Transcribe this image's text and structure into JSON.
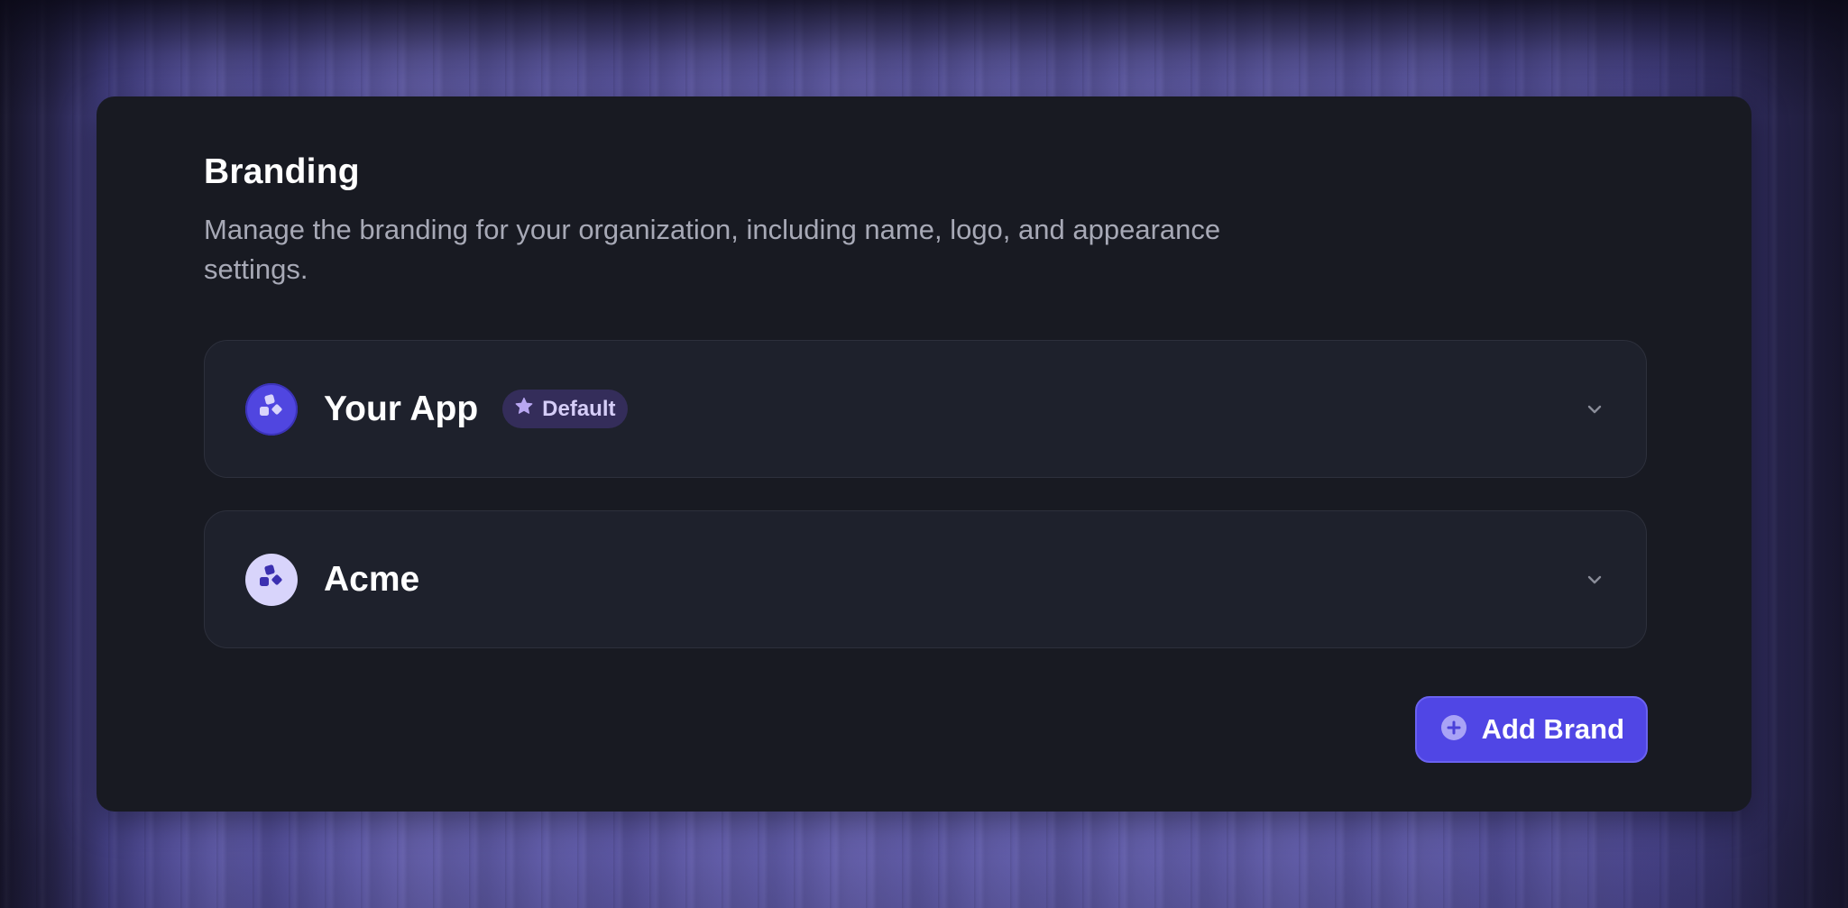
{
  "branding": {
    "title": "Branding",
    "description": "Manage the branding for your organization, including name, logo, and appearance settings."
  },
  "brands": [
    {
      "name": "Your App",
      "badge": "Default",
      "logo_style": "primary",
      "is_default": true
    },
    {
      "name": "Acme",
      "badge": null,
      "logo_style": "light",
      "is_default": false
    }
  ],
  "actions": {
    "add_brand_label": "Add Brand"
  },
  "icons": {
    "brand_logo": "shapes-icon",
    "badge": "star-icon",
    "expand": "chevron-down-icon",
    "add": "plus-circle-icon"
  },
  "colors": {
    "accent": "#5046e5",
    "card_bg": "#181a22",
    "item_bg": "#1e212c",
    "badge_bg": "#342d5a",
    "badge_text": "#d5cdf7",
    "logo_light_bg": "#d8d4fb"
  }
}
